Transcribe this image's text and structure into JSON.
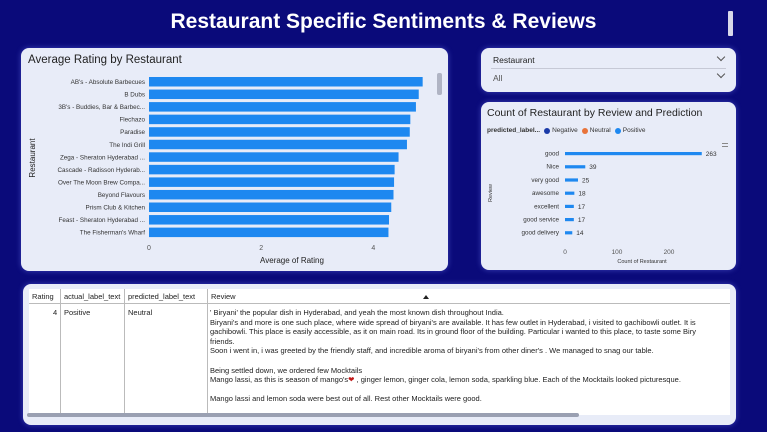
{
  "page": {
    "title": "Restaurant Specific Sentiments & Reviews"
  },
  "slicer": {
    "label": "Restaurant",
    "value": "All"
  },
  "colors": {
    "background": "#0a0a7a",
    "bar": "#1e88f0",
    "negative": "#1a3aa8",
    "neutral": "#e8733a",
    "positive": "#1e88f0"
  },
  "chart_data": [
    {
      "type": "bar",
      "orientation": "horizontal",
      "title": "Average Rating by Restaurant",
      "xlabel": "Average of Rating",
      "ylabel": "Restaurant",
      "categories": [
        "AB's - Absolute Barbecues",
        "B Dubs",
        "3B's - Buddies, Bar & Barbecue",
        "Flechazo",
        "Paradise",
        "The Indi Grill",
        "Zega - Sheraton Hyderabad Hotel",
        "Cascade - Radisson Hyderabad Hitec City",
        "Over The Moon Brew Company",
        "Beyond Flavours",
        "Prism Club & Kitchen",
        "Feast - Sheraton Hyderabad Hotel",
        "The Fisherman's Wharf"
      ],
      "category_labels": [
        "AB's - Absolute Barbecues",
        "B Dubs",
        "3B's - Buddies, Bar & Barbec...",
        "Flechazo",
        "Paradise",
        "The Indi Grill",
        "Zega - Sheraton Hyderabad ...",
        "Cascade - Radisson Hyderab...",
        "Over The Moon Brew Compa...",
        "Beyond Flavours",
        "Prism Club & Kitchen",
        "Feast - Sheraton Hyderabad ...",
        "The Fisherman's Wharf"
      ],
      "values": [
        4.88,
        4.81,
        4.76,
        4.66,
        4.65,
        4.6,
        4.45,
        4.38,
        4.37,
        4.36,
        4.32,
        4.28,
        4.27
      ],
      "xticks": [
        0,
        2,
        4
      ],
      "xlim": [
        0,
        5.1
      ],
      "grid": false
    },
    {
      "type": "bar",
      "orientation": "horizontal",
      "title": "Count of Restaurant by Review and Prediction",
      "xlabel": "Count of Restaurant",
      "ylabel": "Review",
      "legend_title": "predicted_label...",
      "legend": [
        "Negative",
        "Neutral",
        "Positive"
      ],
      "legend_placement": "top-left",
      "categories": [
        "good",
        "Nice",
        "very good",
        "awesome",
        "excellent",
        "good service",
        "good delivery"
      ],
      "values": [
        263,
        39,
        25,
        18,
        17,
        17,
        14
      ],
      "xticks": [
        0,
        100,
        200
      ],
      "xlim": [
        0,
        300
      ],
      "grid": false
    }
  ],
  "table": {
    "columns": [
      "Rating",
      "actual_label_text",
      "predicted_label_text",
      "Review"
    ],
    "rows": [
      {
        "rating": "4",
        "actual": "Positive",
        "predicted": "Neutral",
        "review_lines": [
          "' Biryani' the popular dish in Hyderabad, and yeah the most known dish throughout India.",
          "Biryani's and more is one such place, where wide spread of biryani's are available. It has few outlet in Hyderabad, i visited to gachibowli outlet. It is",
          "gachibowli. This place is easily accessible, as it on main road. Its in ground floor of the building. Particular i wanted to this place, to taste some Biry",
          "friends.",
          "Soon i went in, i was greeted by the friendly staff, and incredible aroma of biryani's from other diner's . We managed to snag our table.",
          "",
          "Being settled down, we ordered few Mocktails",
          "Mango lassi, as this is season of mango's",
          "",
          "Mango lassi and lemon soda were best out of all. Rest other Mocktails were good."
        ],
        "review_line8_suffix": " , ginger lemon, ginger cola, lemon soda, sparkling blue. Each of the Mocktails looked picturesque."
      }
    ]
  }
}
